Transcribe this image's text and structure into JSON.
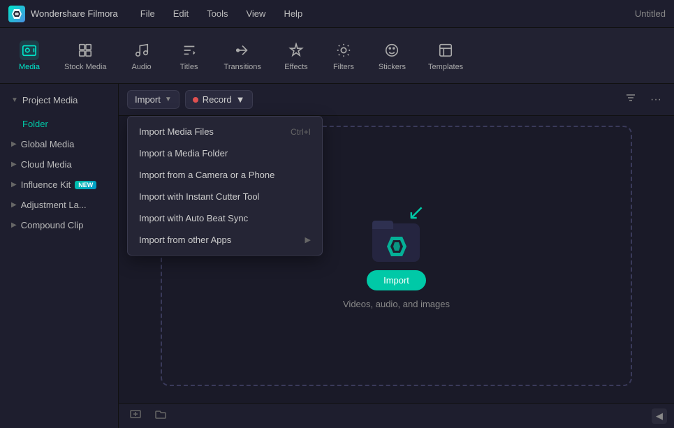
{
  "titlebar": {
    "app_name": "Wondershare Filmora",
    "menu_items": [
      "File",
      "Edit",
      "Tools",
      "View",
      "Help"
    ],
    "title": "Untitled"
  },
  "toolbar": {
    "items": [
      {
        "id": "media",
        "label": "Media",
        "active": true
      },
      {
        "id": "stock-media",
        "label": "Stock Media",
        "active": false
      },
      {
        "id": "audio",
        "label": "Audio",
        "active": false
      },
      {
        "id": "titles",
        "label": "Titles",
        "active": false
      },
      {
        "id": "transitions",
        "label": "Transitions",
        "active": false
      },
      {
        "id": "effects",
        "label": "Effects",
        "active": false
      },
      {
        "id": "filters",
        "label": "Filters",
        "active": false
      },
      {
        "id": "stickers",
        "label": "Stickers",
        "active": false
      },
      {
        "id": "templates",
        "label": "Templates",
        "active": false
      }
    ]
  },
  "sidebar": {
    "folder_label": "Folder",
    "sections": [
      {
        "id": "project-media",
        "label": "Project Media",
        "expanded": true
      },
      {
        "id": "global-media",
        "label": "Global Media",
        "expanded": false
      },
      {
        "id": "cloud-media",
        "label": "Cloud Media",
        "expanded": false
      },
      {
        "id": "influence-kit",
        "label": "Influence Kit",
        "badge": "NEW",
        "expanded": false
      },
      {
        "id": "adjustment-la",
        "label": "Adjustment La...",
        "expanded": false
      },
      {
        "id": "compound-clip",
        "label": "Compound Clip",
        "expanded": false
      }
    ]
  },
  "content_header": {
    "import_label": "Import",
    "record_label": "Record",
    "filter_icon": "⚙",
    "more_icon": "···"
  },
  "import_dropdown": {
    "items": [
      {
        "label": "Import Media Files",
        "shortcut": "Ctrl+I",
        "arrow": false
      },
      {
        "label": "Import a Media Folder",
        "shortcut": "",
        "arrow": false
      },
      {
        "label": "Import from a Camera or a Phone",
        "shortcut": "",
        "arrow": false
      },
      {
        "label": "Import with Instant Cutter Tool",
        "shortcut": "",
        "arrow": false
      },
      {
        "label": "Import with Auto Beat Sync",
        "shortcut": "",
        "arrow": false
      },
      {
        "label": "Import from other Apps",
        "shortcut": "",
        "arrow": true
      }
    ]
  },
  "drop_zone": {
    "import_button": "Import",
    "hint": "Videos, audio, and images"
  },
  "bottom": {
    "add_folder": "+",
    "new_folder": "📁",
    "collapse": "◀"
  }
}
